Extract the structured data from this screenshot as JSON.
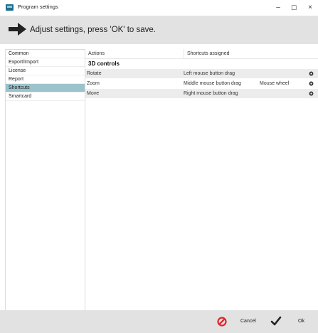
{
  "window": {
    "title": "Program settings",
    "minimize_glyph": "–",
    "maximize_glyph": "☐",
    "close_glyph": "×"
  },
  "banner": {
    "text": "Adjust settings, press 'OK' to save.",
    "icon": "arrow-right-icon"
  },
  "sidebar": {
    "items": [
      {
        "label": "Common",
        "selected": false
      },
      {
        "label": "Export/Import",
        "selected": false
      },
      {
        "label": "License",
        "selected": false
      },
      {
        "label": "Report",
        "selected": false
      },
      {
        "label": "Shortcuts",
        "selected": true
      },
      {
        "label": "Smartcard",
        "selected": false
      }
    ]
  },
  "table": {
    "headers": {
      "actions": "Actions",
      "shortcuts": "Shortcuts assigned"
    },
    "section": "3D controls",
    "rows": [
      {
        "action": "Rotate",
        "shortcut1": "Left mouse button drag",
        "shortcut2": ""
      },
      {
        "action": "Zoom",
        "shortcut1": "Middle mouse button drag",
        "shortcut2": "Mouse wheel"
      },
      {
        "action": "Move",
        "shortcut1": "Right mouse button drag",
        "shortcut2": ""
      }
    ],
    "row_icon": "gear-icon"
  },
  "footer": {
    "cancel_label": "Cancel",
    "ok_label": "Ok",
    "cancel_color": "#e0262b",
    "ok_color": "#222222"
  },
  "colors": {
    "banner_bg": "#e2e2e2",
    "selected_bg": "#9cc2cc",
    "alt_row_bg": "#ececec"
  }
}
